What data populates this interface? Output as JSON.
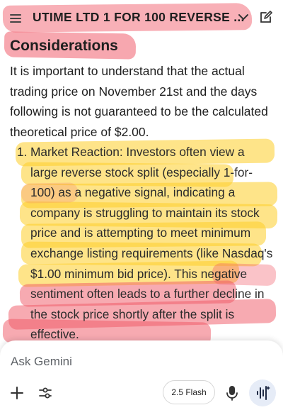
{
  "header": {
    "title": "UTIME LTD 1 FOR 100 REVERSE ...",
    "menu_icon": "menu-icon",
    "chevron_icon": "chevron-down-icon",
    "edit_icon": "edit-icon"
  },
  "content": {
    "heading": "Considerations",
    "paragraph": "It is important to understand that the actual trading price on November 21st and the days following is not guaranteed to be the calculated theoretical price of $2.00.",
    "list": [
      {
        "number": "1.",
        "text": "Market Reaction: Investors often view a large reverse stock split (especially 1-for-100) as a negative signal, indicating a company is struggling to maintain its stock price and is attempting to meet minimum exchange listing requirements (like Nasdaq's $1.00 minimum bid price). This negative sentiment often leads to a further decline in the stock price shortly after the split is effective."
      }
    ]
  },
  "composer": {
    "placeholder": "Ask Gemini",
    "model_label": "2.5 Flash",
    "icons": [
      "plus-icon",
      "tune-icon",
      "mic-icon",
      "live-icon"
    ]
  },
  "colors": {
    "highlight_red": "#f05564",
    "highlight_yellow": "#fdcd28",
    "text": "#1f1f1f"
  }
}
